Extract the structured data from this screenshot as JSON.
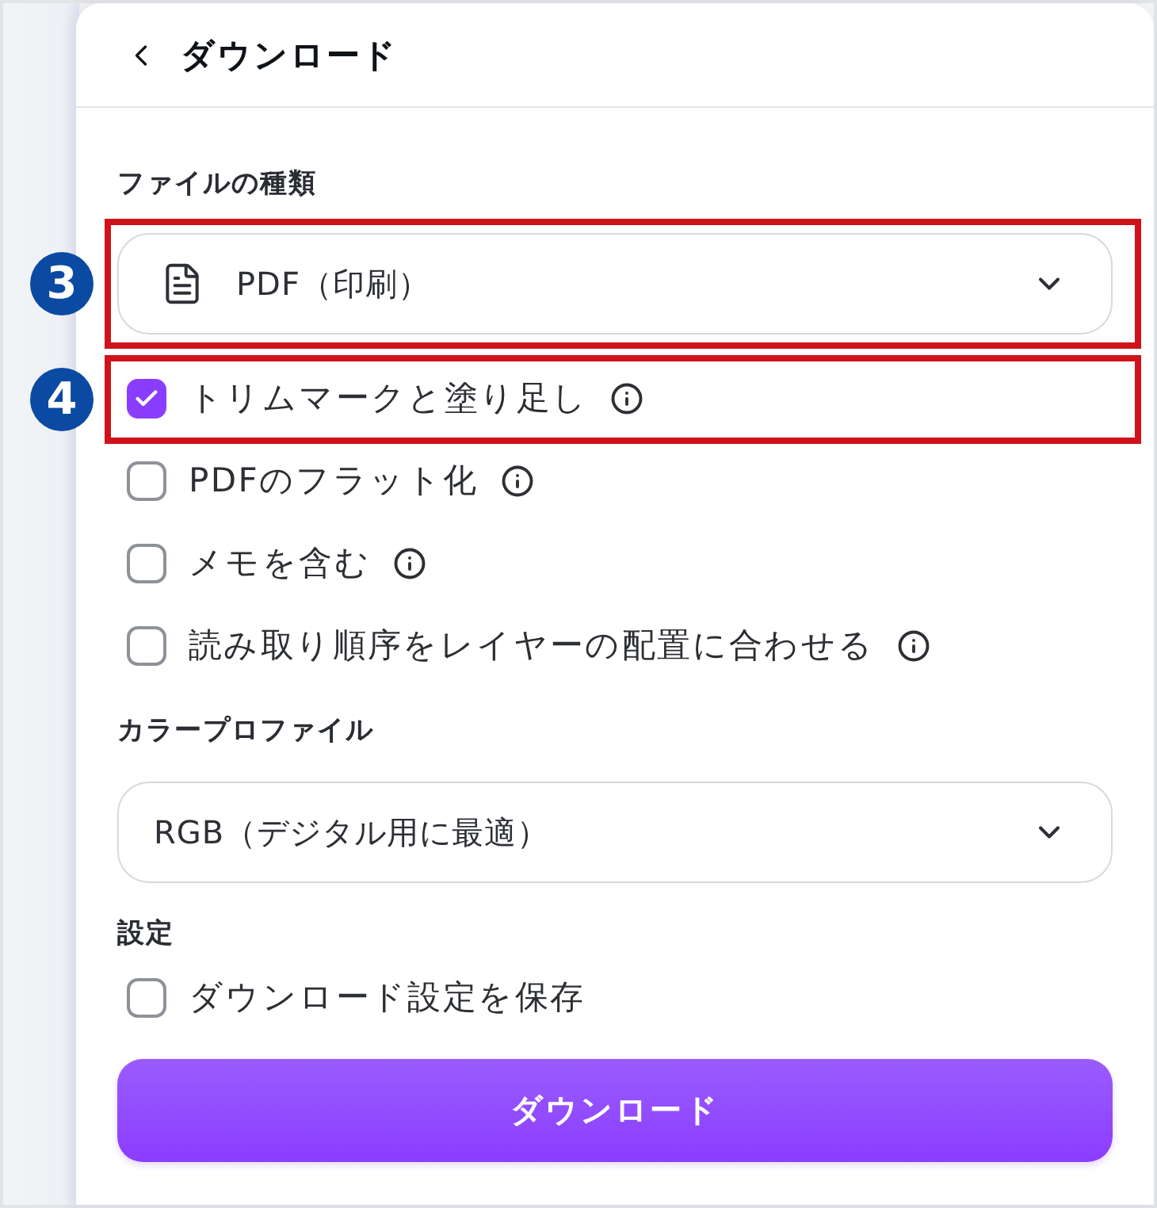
{
  "header": {
    "title": "ダウンロード"
  },
  "file_type": {
    "label": "ファイルの種類",
    "select": {
      "value": "PDF（印刷）"
    },
    "callout": "3"
  },
  "options": [
    {
      "label": "トリムマークと塗り足し",
      "checked": true,
      "info": true,
      "callout": "4"
    },
    {
      "label": "PDFのフラット化",
      "checked": false,
      "info": true
    },
    {
      "label": "メモを含む",
      "checked": false,
      "info": true
    },
    {
      "label": "読み取り順序をレイヤーの配置に合わせる",
      "checked": false,
      "info": true
    }
  ],
  "color_profile": {
    "label": "カラープロファイル",
    "select": {
      "value": "RGB（デジタル用に最適）"
    }
  },
  "settings": {
    "label": "設定",
    "options": [
      {
        "label": "ダウンロード設定を保存",
        "checked": false
      }
    ]
  },
  "download_button": {
    "label": "ダウンロード"
  }
}
